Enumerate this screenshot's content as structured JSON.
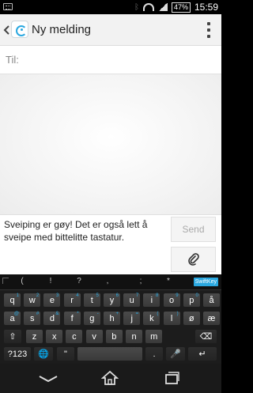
{
  "status_bar": {
    "battery": "47%",
    "time": "15:59",
    "icons": [
      "keyboard-icon",
      "bluetooth-icon",
      "wifi-icon",
      "signal-icon",
      "battery-icon"
    ]
  },
  "appbar": {
    "title": "Ny melding",
    "icons": [
      "back-chevron-icon",
      "messaging-app-icon",
      "overflow-menu-icon"
    ]
  },
  "recipient": {
    "label": "Til:"
  },
  "compose": {
    "message": "Sveiping er gøy! Det er også lett å sveipe med bittelitte tastatur.",
    "send_label": "Send",
    "attach_icon": "paperclip-icon"
  },
  "keyboard": {
    "symbols": [
      "(",
      "!",
      "?",
      ",",
      ";",
      "*"
    ],
    "brand": "SwiftKey",
    "row1": [
      {
        "k": "q",
        "h": "1"
      },
      {
        "k": "w",
        "h": "2"
      },
      {
        "k": "e",
        "h": "3"
      },
      {
        "k": "r",
        "h": "4"
      },
      {
        "k": "t",
        "h": "5"
      },
      {
        "k": "y",
        "h": "6"
      },
      {
        "k": "u",
        "h": "7"
      },
      {
        "k": "i",
        "h": "8"
      },
      {
        "k": "o",
        "h": "9"
      },
      {
        "k": "p",
        "h": "0"
      },
      {
        "k": "å",
        "h": ""
      }
    ],
    "row2": [
      {
        "k": "a",
        "h": "@"
      },
      {
        "k": "s",
        "h": "#"
      },
      {
        "k": "d",
        "h": "&"
      },
      {
        "k": "f",
        "h": "*"
      },
      {
        "k": "g",
        "h": "-"
      },
      {
        "k": "h",
        "h": "+"
      },
      {
        "k": "j",
        "h": "="
      },
      {
        "k": "k",
        "h": "("
      },
      {
        "k": "l",
        "h": ")"
      },
      {
        "k": "ø",
        "h": ""
      },
      {
        "k": "æ",
        "h": ""
      }
    ],
    "row3": [
      {
        "k": "⇧",
        "h": ""
      },
      {
        "k": "z",
        "h": ""
      },
      {
        "k": "x",
        "h": ""
      },
      {
        "k": "c",
        "h": ""
      },
      {
        "k": "v",
        "h": ""
      },
      {
        "k": "b",
        "h": ""
      },
      {
        "k": "n",
        "h": ""
      },
      {
        "k": "m",
        "h": ""
      },
      {
        "k": "⌫",
        "h": ""
      }
    ],
    "row4": {
      "sym_label": "?123",
      "globe": "🌐",
      "quote": "\"",
      "period": ".",
      "mic": "🎤",
      "enter": "↵"
    }
  },
  "nav": {
    "icons": [
      "back-icon",
      "home-icon",
      "recent-apps-icon"
    ]
  },
  "colors": {
    "accent": "#2aa8e0",
    "keyboard_bg": "#1c1c1c"
  }
}
